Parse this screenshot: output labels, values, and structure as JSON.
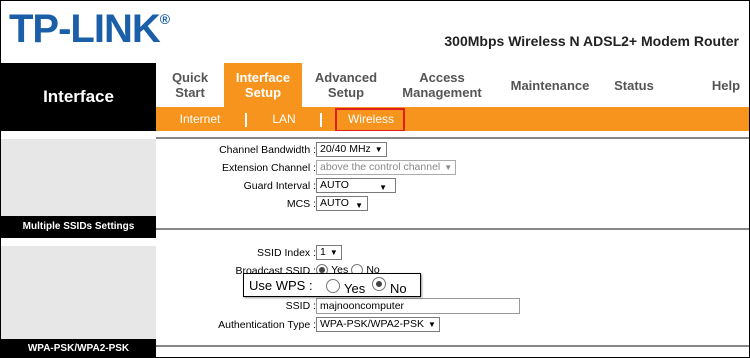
{
  "brand": {
    "logo": "TP-LINK",
    "reg": "®",
    "model": "300Mbps Wireless N ADSL2+ Modem Router"
  },
  "sidebar": {
    "title": "Interface",
    "sections": [
      "Multiple SSIDs Settings",
      "WPA-PSK/WPA2-PSK"
    ]
  },
  "nav": {
    "items": [
      {
        "line1": "Quick",
        "line2": "Start"
      },
      {
        "line1": "Interface",
        "line2": "Setup"
      },
      {
        "line1": "Advanced",
        "line2": "Setup"
      },
      {
        "line1": "Access",
        "line2": "Management"
      },
      {
        "line1": "Maintenance",
        "line2": ""
      },
      {
        "line1": "Status",
        "line2": ""
      },
      {
        "line1": "Help",
        "line2": ""
      }
    ],
    "active_index": 1
  },
  "subnav": {
    "items": [
      "Internet",
      "LAN",
      "Wireless"
    ],
    "selected": "Wireless"
  },
  "form": {
    "channel_bandwidth": {
      "label": "Channel Bandwidth :",
      "value": "20/40 MHz"
    },
    "extension_channel": {
      "label": "Extension Channel :",
      "value": "above the control channel"
    },
    "guard_interval": {
      "label": "Guard Interval :",
      "value": "AUTO"
    },
    "mcs": {
      "label": "MCS :",
      "value": "AUTO"
    },
    "ssid_index": {
      "label": "SSID Index :",
      "value": "1"
    },
    "broadcast_ssid": {
      "label": "Broadcast SSID :",
      "yes": "Yes",
      "no": "No"
    },
    "ssid": {
      "label": "SSID :",
      "value": "majnooncomputer"
    },
    "auth_type": {
      "label": "Authentication Type :",
      "value": "WPA-PSK/WPA2-PSK"
    }
  },
  "wps_popup": {
    "label": "Use WPS :",
    "yes": "Yes",
    "no": "No",
    "selected": "No"
  },
  "colors": {
    "accent": "#f7941d",
    "logo": "#1a5fa8",
    "highlight": "#e02020"
  }
}
